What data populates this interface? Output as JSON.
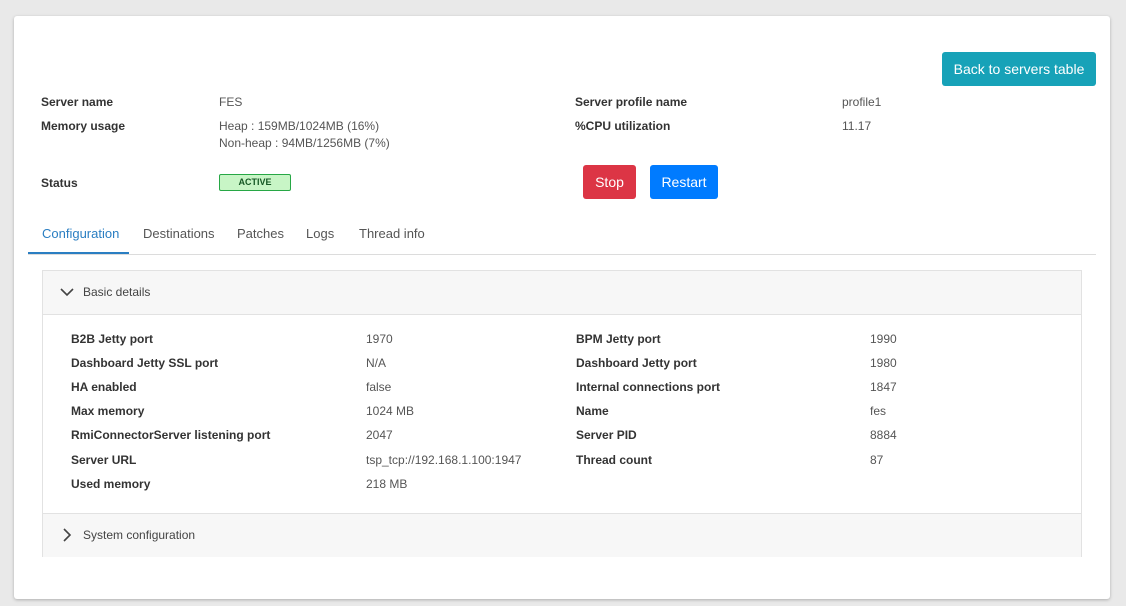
{
  "header": {
    "back_button": "Back to servers table",
    "server_name_label": "Server name",
    "server_name_value": "FES",
    "memory_label": "Memory usage",
    "memory_heap": "Heap : 159MB/1024MB (16%)",
    "memory_nonheap": "Non-heap : 94MB/1256MB (7%)",
    "status_label": "Status",
    "status_value": "ACTIVE",
    "profile_label": "Server profile name",
    "profile_value": "profile1",
    "cpu_label": "%CPU utilization",
    "cpu_value": "11.17",
    "stop_button": "Stop",
    "restart_button": "Restart"
  },
  "tabs": [
    {
      "label": "Configuration",
      "active": true
    },
    {
      "label": "Destinations"
    },
    {
      "label": "Patches"
    },
    {
      "label": "Logs"
    },
    {
      "label": "Thread info"
    }
  ],
  "basic_details": {
    "title": "Basic details",
    "left": [
      {
        "label": "B2B Jetty port",
        "value": "1970"
      },
      {
        "label": "Dashboard Jetty SSL port",
        "value": "N/A"
      },
      {
        "label": "HA enabled",
        "value": "false"
      },
      {
        "label": "Max memory",
        "value": "1024 MB"
      },
      {
        "label": "RmiConnectorServer listening port",
        "value": "2047"
      },
      {
        "label": "Server URL",
        "value": "tsp_tcp://192.168.1.100:1947"
      },
      {
        "label": "Used memory",
        "value": "218 MB"
      }
    ],
    "right": [
      {
        "label": "BPM Jetty port",
        "value": "1990"
      },
      {
        "label": "Dashboard Jetty port",
        "value": "1980"
      },
      {
        "label": "Internal connections port",
        "value": "1847"
      },
      {
        "label": "Name",
        "value": "fes"
      },
      {
        "label": "Server PID",
        "value": "8884"
      },
      {
        "label": "Thread count",
        "value": "87"
      }
    ]
  },
  "system_configuration": {
    "title": "System configuration"
  },
  "colors": {
    "back": "#17a2b8",
    "stop": "#dc3545",
    "restart": "#007bff",
    "active_tab": "#2a7ec2",
    "badge_bg": "#c8f5c6"
  }
}
